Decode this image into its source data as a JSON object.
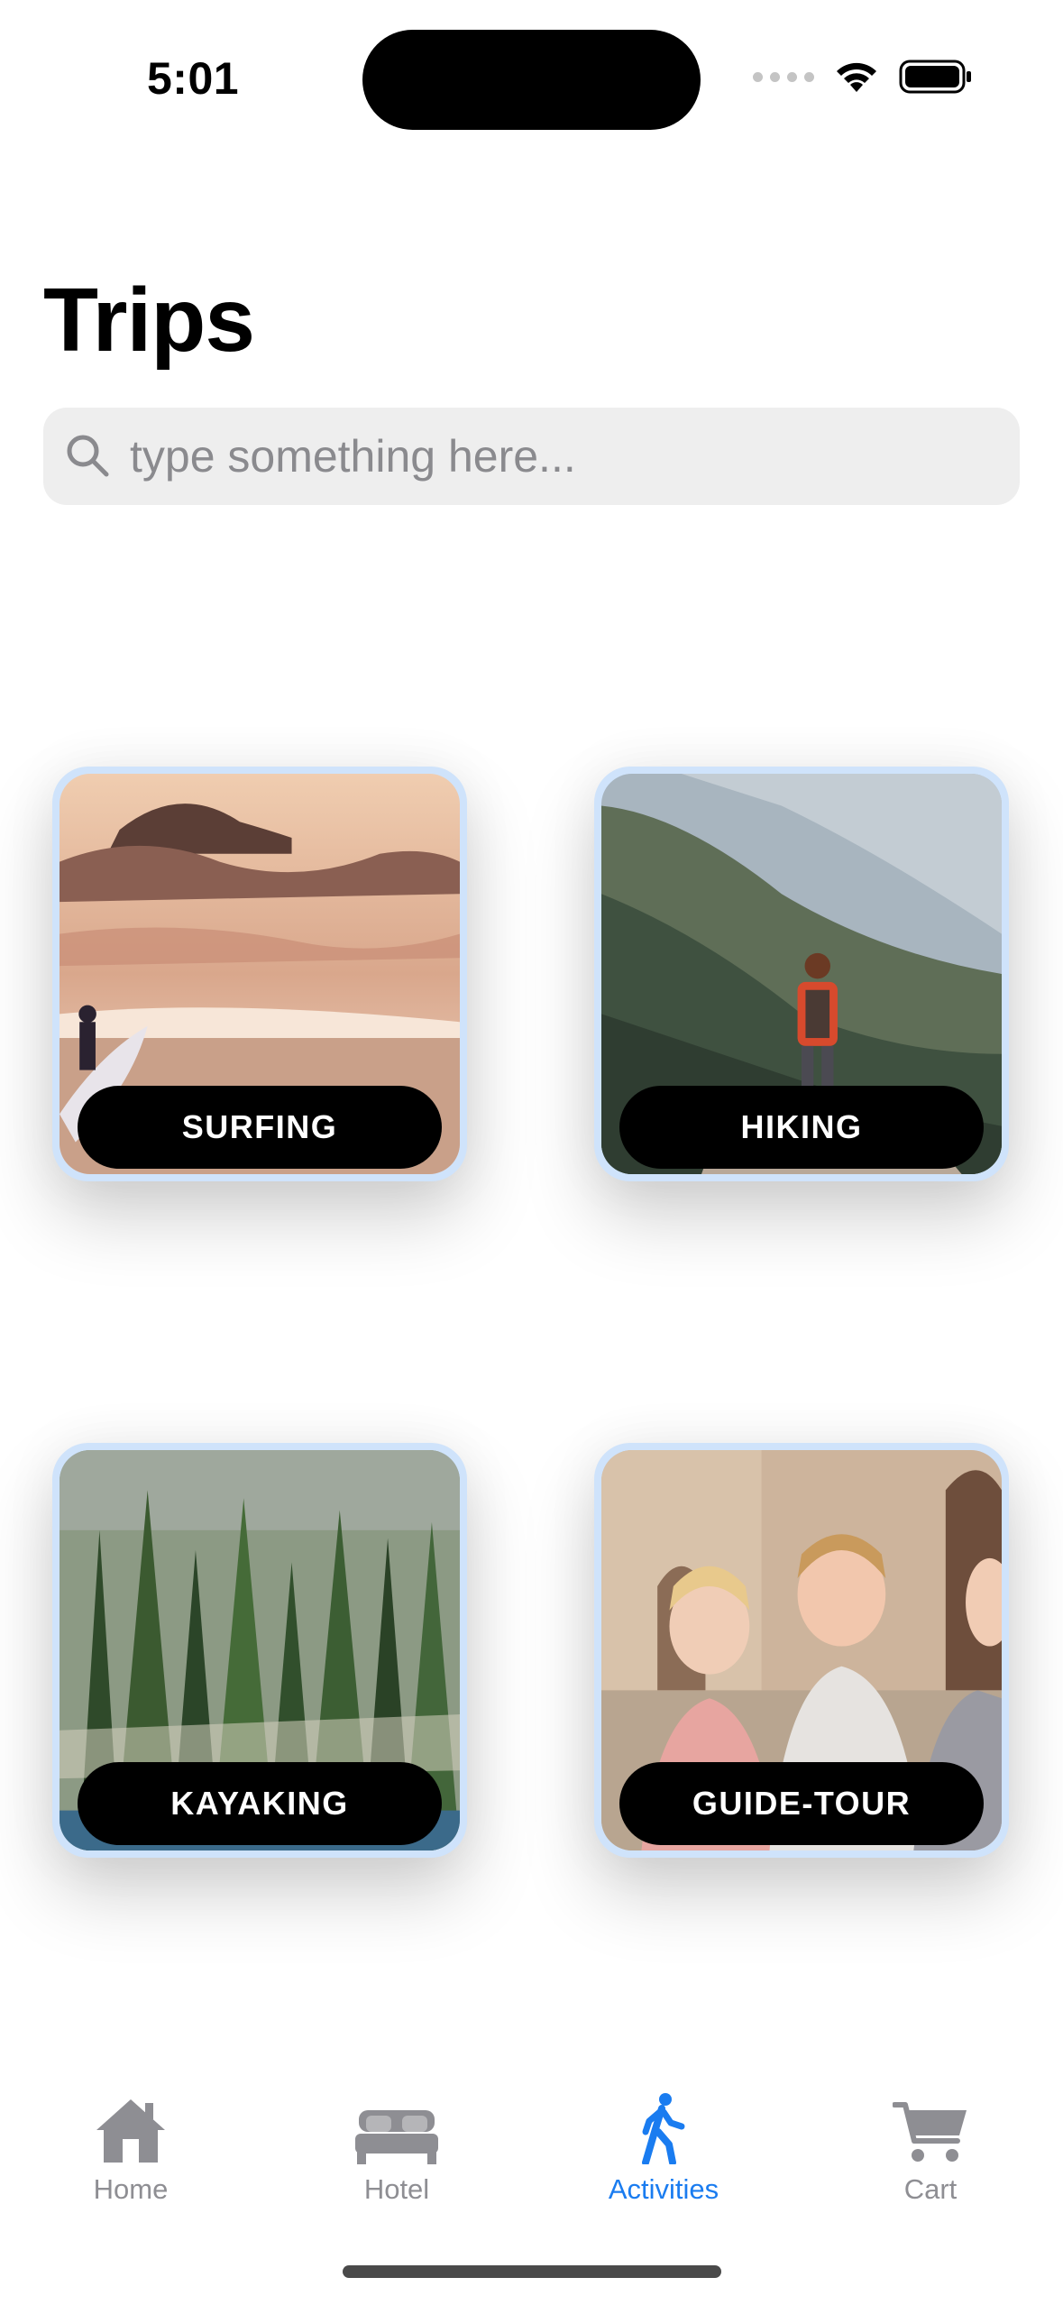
{
  "status_bar": {
    "time": "5:01"
  },
  "page": {
    "title": "Trips"
  },
  "search": {
    "placeholder": "type something here...",
    "value": ""
  },
  "activities": [
    {
      "label": "SURFING"
    },
    {
      "label": "HIKING"
    },
    {
      "label": "KAYAKING"
    },
    {
      "label": "GUIDE-TOUR"
    }
  ],
  "tabbar": {
    "items": [
      {
        "label": "Home",
        "icon": "house-icon"
      },
      {
        "label": "Hotel",
        "icon": "bed-icon"
      },
      {
        "label": "Activities",
        "icon": "walking-figure-icon"
      },
      {
        "label": "Cart",
        "icon": "cart-icon"
      }
    ],
    "active": "Activities"
  },
  "colors": {
    "accent": "#1a7cf0",
    "inactive_tab": "#8e8e93",
    "search_bg": "#eeeeee",
    "card_border": "#cfe3fb",
    "label_bg": "#000000"
  }
}
